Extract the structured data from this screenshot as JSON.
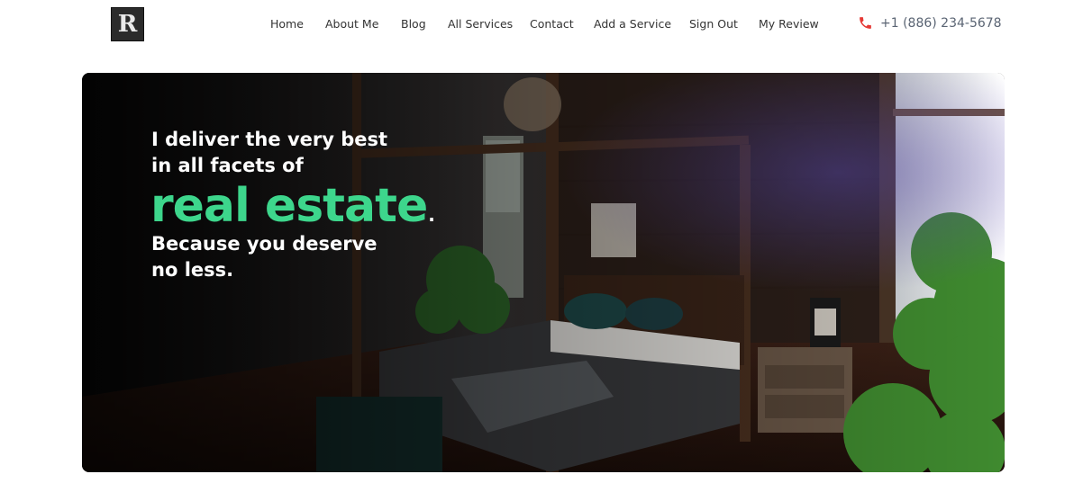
{
  "header": {
    "logo_letter": "R",
    "nav": [
      {
        "label": "Home"
      },
      {
        "label": "About Me"
      },
      {
        "label": "Blog"
      },
      {
        "label": "All Services"
      },
      {
        "label": "Contact"
      },
      {
        "label": "Add a Service"
      },
      {
        "label": "Sign Out"
      },
      {
        "label": "My Review"
      }
    ],
    "phone": {
      "icon": "phone-icon",
      "number": "+1 (886) 234-5678",
      "icon_color": "#e53935"
    }
  },
  "hero": {
    "line1": "I deliver the very best",
    "line2": "in all facets of",
    "highlight": "real estate",
    "period": ".",
    "line3": "Because you deserve",
    "line4": "no less.",
    "accent_color": "#3dd68c",
    "background": "bedroom-photo"
  }
}
